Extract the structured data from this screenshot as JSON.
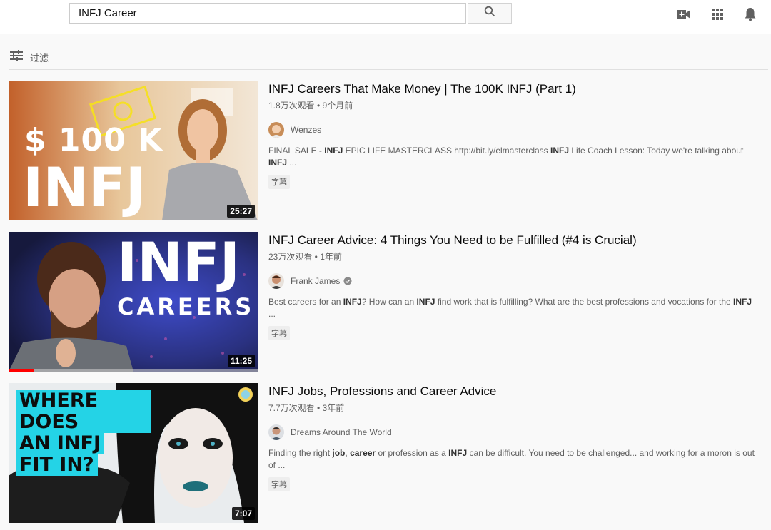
{
  "search": {
    "query": "INFJ Career"
  },
  "filter": {
    "label": "过滤"
  },
  "results": [
    {
      "title": "INFJ Careers That Make Money | The 100K INFJ (Part 1)",
      "meta": "1.8万次观看 • 9个月前",
      "channel": "Wenzes",
      "verified": false,
      "desc_parts": [
        {
          "t": "FINAL SALE - ",
          "b": false
        },
        {
          "t": "INFJ",
          "b": true
        },
        {
          "t": " EPIC LIFE MASTERCLASS http://bit.ly/elmasterclass ",
          "b": false
        },
        {
          "t": "INFJ",
          "b": true
        },
        {
          "t": " Life Coach Lesson: Today we're talking about ",
          "b": false
        },
        {
          "t": "INFJ",
          "b": true
        },
        {
          "t": " ...",
          "b": false
        }
      ],
      "badge": "字幕",
      "duration": "25:27",
      "thumb_text": [
        "$ 100 K",
        "INFJ"
      ]
    },
    {
      "title": "INFJ Career Advice: 4 Things You Need to be Fulfilled (#4 is Crucial)",
      "meta": "23万次观看 • 1年前",
      "channel": "Frank James",
      "verified": true,
      "desc_parts": [
        {
          "t": "Best careers for an ",
          "b": false
        },
        {
          "t": "INFJ",
          "b": true
        },
        {
          "t": "? How can an ",
          "b": false
        },
        {
          "t": "INFJ",
          "b": true
        },
        {
          "t": " find work that is fulfilling? What are the best professions and vocations for the ",
          "b": false
        },
        {
          "t": "INFJ",
          "b": true
        },
        {
          "t": " ...",
          "b": false
        }
      ],
      "badge": "字幕",
      "duration": "11:25",
      "watched_fraction": 0.1,
      "thumb_text": [
        "INFJ",
        "CAREERS"
      ]
    },
    {
      "title": "INFJ Jobs, Professions and Career Advice",
      "meta": "7.7万次观看 • 3年前",
      "channel": "Dreams Around The World",
      "verified": false,
      "desc_parts": [
        {
          "t": "Finding the right ",
          "b": false
        },
        {
          "t": "job",
          "b": true
        },
        {
          "t": ", ",
          "b": false
        },
        {
          "t": "career",
          "b": true
        },
        {
          "t": " or profession as a ",
          "b": false
        },
        {
          "t": "INFJ",
          "b": true
        },
        {
          "t": " can be difficult. You need to be challenged... and working for a moron is out of ...",
          "b": false
        }
      ],
      "badge": "字幕",
      "duration": "7:07",
      "thumb_text": [
        "WHERE DOES",
        "AN INFJ",
        "FIT IN?"
      ]
    }
  ],
  "icons": {
    "search": "search-icon",
    "create": "video-camera-plus-icon",
    "apps": "apps-grid-icon",
    "notifications": "bell-icon",
    "filter": "filter-sliders-icon"
  },
  "colors": {
    "progress": "#ff0000",
    "accent_cyan": "#24d3e6"
  }
}
